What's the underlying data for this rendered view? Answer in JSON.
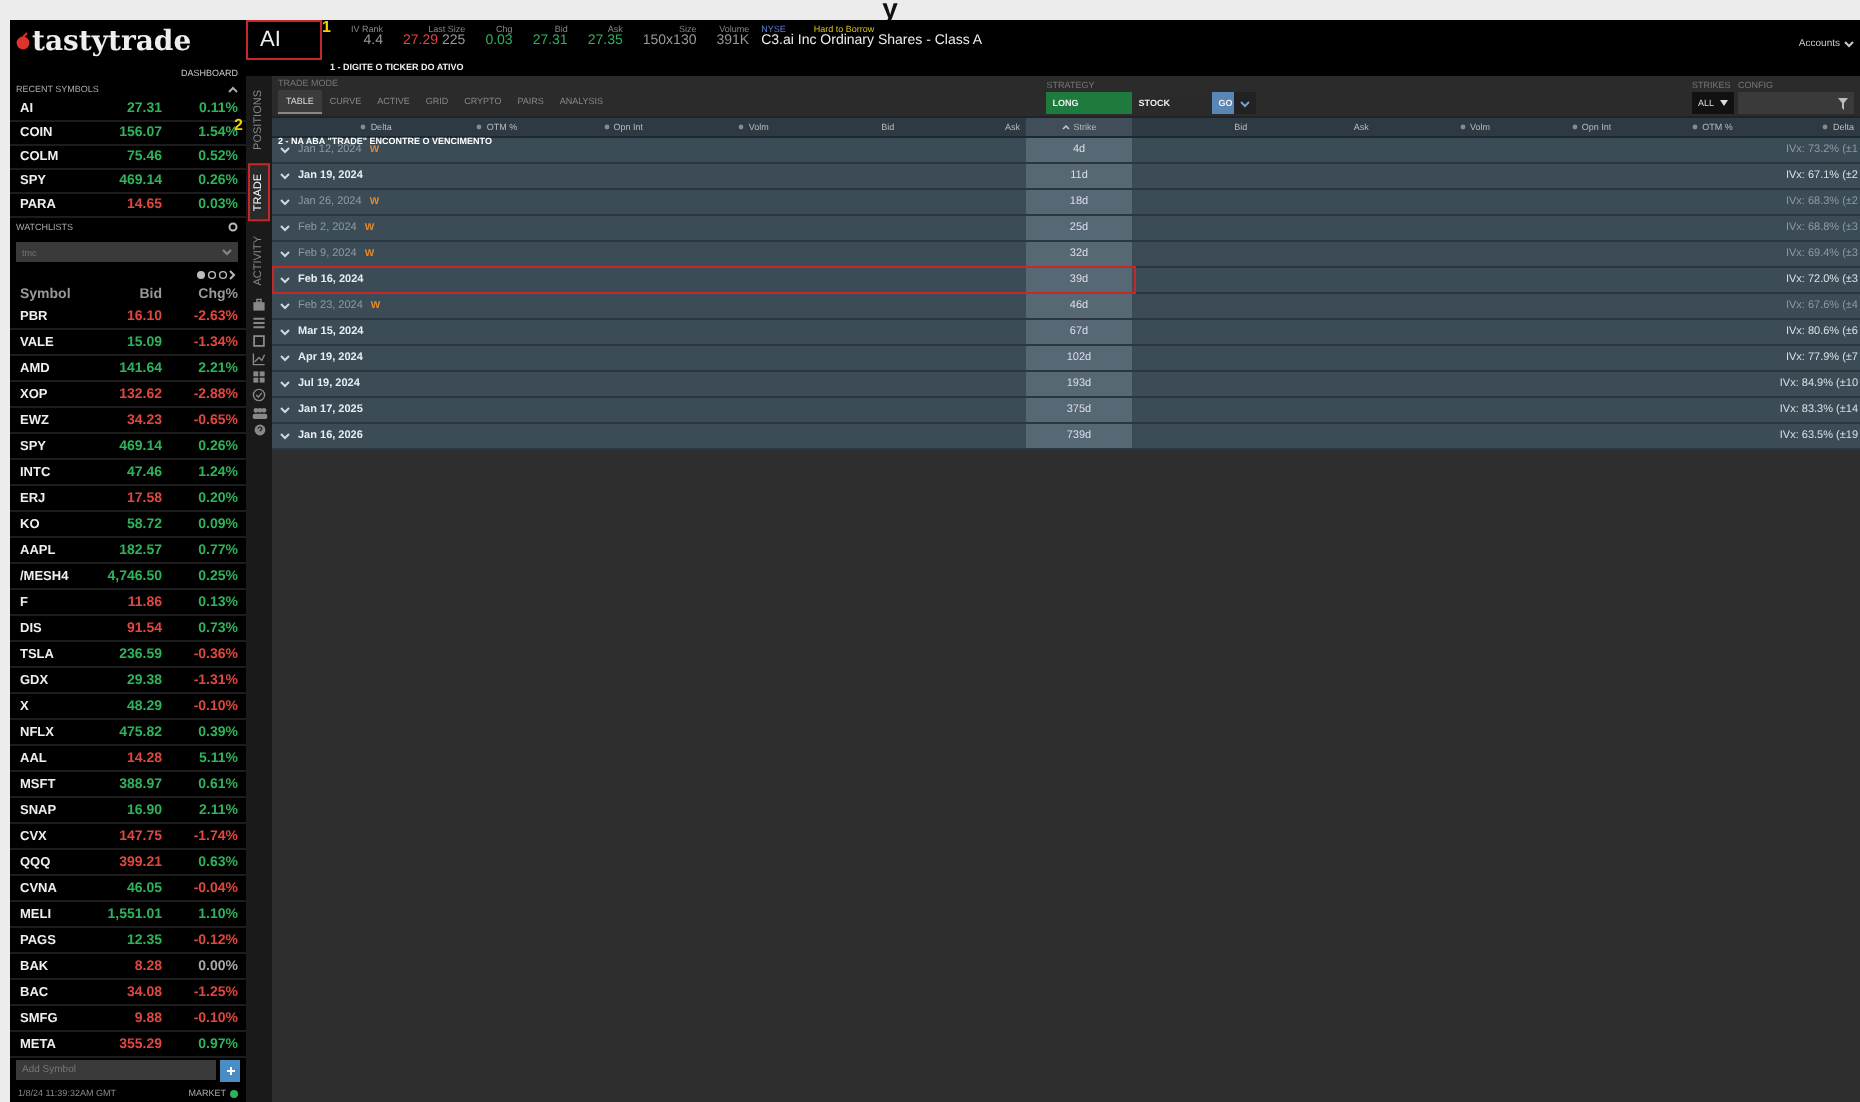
{
  "top_caption": "y",
  "brand": {
    "logo": "tastytrade",
    "dashboard": "DASHBOARD"
  },
  "recent_symbols": {
    "title": "RECENT SYMBOLS",
    "rows": [
      {
        "symbol": "AI",
        "bid": {
          "value": "27.31",
          "color": "#2fb35a"
        },
        "chg": {
          "value": "0.11%",
          "color": "#2fb35a"
        }
      },
      {
        "symbol": "COIN",
        "bid": {
          "value": "156.07",
          "color": "#2fb35a"
        },
        "chg": {
          "value": "1.54%",
          "color": "#2fb35a"
        }
      },
      {
        "symbol": "COLM",
        "bid": {
          "value": "75.46",
          "color": "#2fb35a"
        },
        "chg": {
          "value": "0.52%",
          "color": "#2fb35a"
        }
      },
      {
        "symbol": "SPY",
        "bid": {
          "value": "469.14",
          "color": "#2fb35a"
        },
        "chg": {
          "value": "0.26%",
          "color": "#2fb35a"
        }
      },
      {
        "symbol": "PARA",
        "bid": {
          "value": "14.65",
          "color": "#e0473f"
        },
        "chg": {
          "value": "0.03%",
          "color": "#2fb35a"
        }
      }
    ]
  },
  "watchlists": {
    "title": "WATCHLISTS",
    "selector": "tmc",
    "columns": [
      "Symbol",
      "Bid",
      "Chg%"
    ],
    "rows": [
      {
        "symbol": "PBR",
        "bid": {
          "value": "16.10",
          "color": "#e0473f"
        },
        "chg": {
          "value": "-2.63%",
          "color": "#e0473f"
        }
      },
      {
        "symbol": "VALE",
        "bid": {
          "value": "15.09",
          "color": "#2fb35a"
        },
        "chg": {
          "value": "-1.34%",
          "color": "#e0473f"
        }
      },
      {
        "symbol": "AMD",
        "bid": {
          "value": "141.64",
          "color": "#2fb35a"
        },
        "chg": {
          "value": "2.21%",
          "color": "#2fb35a"
        }
      },
      {
        "symbol": "XOP",
        "bid": {
          "value": "132.62",
          "color": "#e0473f"
        },
        "chg": {
          "value": "-2.88%",
          "color": "#e0473f"
        }
      },
      {
        "symbol": "EWZ",
        "bid": {
          "value": "34.23",
          "color": "#e0473f"
        },
        "chg": {
          "value": "-0.65%",
          "color": "#e0473f"
        }
      },
      {
        "symbol": "SPY",
        "bid": {
          "value": "469.14",
          "color": "#2fb35a"
        },
        "chg": {
          "value": "0.26%",
          "color": "#2fb35a"
        }
      },
      {
        "symbol": "INTC",
        "bid": {
          "value": "47.46",
          "color": "#2fb35a"
        },
        "chg": {
          "value": "1.24%",
          "color": "#2fb35a"
        }
      },
      {
        "symbol": "ERJ",
        "bid": {
          "value": "17.58",
          "color": "#e0473f"
        },
        "chg": {
          "value": "0.20%",
          "color": "#2fb35a"
        }
      },
      {
        "symbol": "KO",
        "bid": {
          "value": "58.72",
          "color": "#2fb35a"
        },
        "chg": {
          "value": "0.09%",
          "color": "#2fb35a"
        }
      },
      {
        "symbol": "AAPL",
        "bid": {
          "value": "182.57",
          "color": "#2fb35a"
        },
        "chg": {
          "value": "0.77%",
          "color": "#2fb35a"
        }
      },
      {
        "symbol": "/MESH4",
        "bid": {
          "value": "4,746.50",
          "color": "#2fb35a"
        },
        "chg": {
          "value": "0.25%",
          "color": "#2fb35a"
        }
      },
      {
        "symbol": "F",
        "bid": {
          "value": "11.86",
          "color": "#e0473f"
        },
        "chg": {
          "value": "0.13%",
          "color": "#2fb35a"
        }
      },
      {
        "symbol": "DIS",
        "bid": {
          "value": "91.54",
          "color": "#e0473f"
        },
        "chg": {
          "value": "0.73%",
          "color": "#2fb35a"
        }
      },
      {
        "symbol": "TSLA",
        "bid": {
          "value": "236.59",
          "color": "#2fb35a"
        },
        "chg": {
          "value": "-0.36%",
          "color": "#e0473f"
        }
      },
      {
        "symbol": "GDX",
        "bid": {
          "value": "29.38",
          "color": "#2fb35a"
        },
        "chg": {
          "value": "-1.31%",
          "color": "#e0473f"
        }
      },
      {
        "symbol": "X",
        "bid": {
          "value": "48.29",
          "color": "#2fb35a"
        },
        "chg": {
          "value": "-0.10%",
          "color": "#e0473f"
        }
      },
      {
        "symbol": "NFLX",
        "bid": {
          "value": "475.82",
          "color": "#2fb35a"
        },
        "chg": {
          "value": "0.39%",
          "color": "#2fb35a"
        }
      },
      {
        "symbol": "AAL",
        "bid": {
          "value": "14.28",
          "color": "#e0473f"
        },
        "chg": {
          "value": "5.11%",
          "color": "#2fb35a"
        }
      },
      {
        "symbol": "MSFT",
        "bid": {
          "value": "388.97",
          "color": "#2fb35a"
        },
        "chg": {
          "value": "0.61%",
          "color": "#2fb35a"
        }
      },
      {
        "symbol": "SNAP",
        "bid": {
          "value": "16.90",
          "color": "#2fb35a"
        },
        "chg": {
          "value": "2.11%",
          "color": "#2fb35a"
        }
      },
      {
        "symbol": "CVX",
        "bid": {
          "value": "147.75",
          "color": "#e0473f"
        },
        "chg": {
          "value": "-1.74%",
          "color": "#e0473f"
        }
      },
      {
        "symbol": "QQQ",
        "bid": {
          "value": "399.21",
          "color": "#e0473f"
        },
        "chg": {
          "value": "0.63%",
          "color": "#2fb35a"
        }
      },
      {
        "symbol": "CVNA",
        "bid": {
          "value": "46.05",
          "color": "#2fb35a"
        },
        "chg": {
          "value": "-0.04%",
          "color": "#e0473f"
        }
      },
      {
        "symbol": "MELI",
        "bid": {
          "value": "1,551.01",
          "color": "#2fb35a"
        },
        "chg": {
          "value": "1.10%",
          "color": "#2fb35a"
        }
      },
      {
        "symbol": "PAGS",
        "bid": {
          "value": "12.35",
          "color": "#2fb35a"
        },
        "chg": {
          "value": "-0.12%",
          "color": "#e0473f"
        }
      },
      {
        "symbol": "BAK",
        "bid": {
          "value": "8.28",
          "color": "#e0473f"
        },
        "chg": {
          "value": "0.00%",
          "color": "#aaaaaa"
        }
      },
      {
        "symbol": "BAC",
        "bid": {
          "value": "34.08",
          "color": "#e0473f"
        },
        "chg": {
          "value": "-1.25%",
          "color": "#e0473f"
        }
      },
      {
        "symbol": "SMFG",
        "bid": {
          "value": "9.88",
          "color": "#e0473f"
        },
        "chg": {
          "value": "-0.10%",
          "color": "#e0473f"
        }
      },
      {
        "symbol": "META",
        "bid": {
          "value": "355.29",
          "color": "#e0473f"
        },
        "chg": {
          "value": "0.97%",
          "color": "#2fb35a"
        }
      }
    ],
    "add_symbol": {
      "placeholder": "Add Symbol"
    },
    "timestamp": "1/8/24 11:39:32AM GMT",
    "market": "MARKET"
  },
  "ticker": {
    "value": "AI",
    "step": "1",
    "hint": "1 - DIGITE O TICKER DO ATIVO"
  },
  "quote": [
    {
      "label": "IV Rank",
      "value": "4.4",
      "color": "#999999"
    },
    {
      "label": "Last Size",
      "value": "27.29",
      "extra": "225",
      "color": "#e0473f"
    },
    {
      "label": "Chg",
      "value": "0.03",
      "color": "#2fb35a"
    },
    {
      "label": "Bid",
      "value": "27.31",
      "color": "#2fb35a"
    },
    {
      "label": "Ask",
      "value": "27.35",
      "color": "#2fb35a"
    },
    {
      "label": "Size",
      "value": "150x130",
      "color": "#999999"
    },
    {
      "label": "Volume",
      "value": "391K",
      "color": "#999999"
    }
  ],
  "instrument": {
    "exchange": "NYSE",
    "flag": "Hard to Borrow",
    "name": "C3.ai Inc Ordinary Shares - Class A"
  },
  "accounts": "Accounts",
  "side_tabs": [
    {
      "label": "POSITIONS",
      "selected": false
    },
    {
      "label": "TRADE",
      "selected": true
    },
    {
      "label": "ACTIVITY",
      "selected": false
    }
  ],
  "side_step": "2",
  "trade_mode": {
    "label": "TRADE MODE",
    "tabs": [
      {
        "label": "TABLE",
        "selected": true
      },
      {
        "label": "CURVE",
        "selected": false
      },
      {
        "label": "ACTIVE",
        "selected": false
      },
      {
        "label": "GRID",
        "selected": false
      },
      {
        "label": "CRYPTO",
        "selected": false
      },
      {
        "label": "PAIRS",
        "selected": false
      },
      {
        "label": "ANALYSIS",
        "selected": false
      }
    ]
  },
  "strategy": {
    "label": "STRATEGY",
    "direction": "LONG",
    "type": "STOCK",
    "go": "GO"
  },
  "strikes": {
    "label": "STRIKES",
    "value": "ALL"
  },
  "config": {
    "label": "CONFIG"
  },
  "table": {
    "hint": "2 - NA ABA \"TRADE\" ENCONTRE O VENCIMENTO",
    "calls": [
      {
        "label": "Delta",
        "kind": "toggle"
      },
      {
        "label": "OTM %",
        "kind": "toggle"
      },
      {
        "label": "Opn Int",
        "kind": "toggle"
      },
      {
        "label": "Volm",
        "kind": "toggle"
      },
      {
        "label": "Bid",
        "kind": "plain"
      },
      {
        "label": "Ask",
        "kind": "plain"
      }
    ],
    "strike": {
      "label": "Strike",
      "kind": "sorted"
    },
    "puts": [
      {
        "label": "Bid",
        "kind": "plain"
      },
      {
        "label": "Ask",
        "kind": "plain"
      },
      {
        "label": "Volm",
        "kind": "toggle"
      },
      {
        "label": "Opn Int",
        "kind": "toggle"
      },
      {
        "label": "OTM %",
        "kind": "toggle"
      },
      {
        "label": "Delta",
        "kind": "toggle"
      }
    ],
    "expirations": [
      {
        "date": "Jan 12, 2024",
        "tag": "W",
        "days": "4d",
        "iv": "IVx: 73.2% (±1",
        "weekly": true,
        "marked": false
      },
      {
        "date": "Jan 19, 2024",
        "days": "11d",
        "iv": "IVx: 67.1% (±2",
        "weekly": false,
        "marked": false
      },
      {
        "date": "Jan 26, 2024",
        "tag": "W",
        "days": "18d",
        "iv": "IVx: 68.3% (±2",
        "weekly": true,
        "marked": false
      },
      {
        "date": "Feb 2, 2024",
        "tag": "W",
        "days": "25d",
        "iv": "IVx: 68.8% (±3",
        "weekly": true,
        "marked": false
      },
      {
        "date": "Feb 9, 2024",
        "tag": "W",
        "days": "32d",
        "iv": "IVx: 69.4% (±3",
        "weekly": true,
        "marked": false
      },
      {
        "date": "Feb 16, 2024",
        "days": "39d",
        "iv": "IVx: 72.0% (±3",
        "weekly": false,
        "marked": true
      },
      {
        "date": "Feb 23, 2024",
        "tag": "W",
        "days": "46d",
        "iv": "IVx: 67.6% (±4",
        "weekly": true,
        "marked": false
      },
      {
        "date": "Mar 15, 2024",
        "days": "67d",
        "iv": "IVx: 80.6% (±6",
        "weekly": false,
        "marked": false
      },
      {
        "date": "Apr 19, 2024",
        "days": "102d",
        "iv": "IVx: 77.9% (±7",
        "weekly": false,
        "marked": false
      },
      {
        "date": "Jul 19, 2024",
        "days": "193d",
        "iv": "IVx: 84.9% (±10",
        "weekly": false,
        "marked": false
      },
      {
        "date": "Jan 17, 2025",
        "days": "375d",
        "iv": "IVx: 83.3% (±14",
        "weekly": false,
        "marked": false
      },
      {
        "date": "Jan 16, 2026",
        "days": "739d",
        "iv": "IVx: 63.5% (±19",
        "weekly": false,
        "marked": false
      }
    ]
  }
}
